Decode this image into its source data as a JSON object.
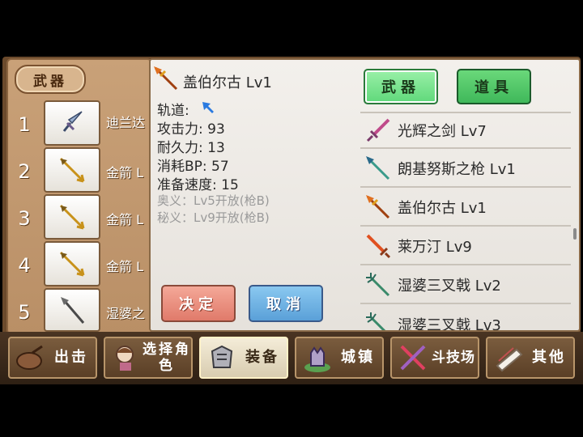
{
  "left_panel": {
    "tab_label": "武器",
    "slots": [
      {
        "num": "1",
        "name": "迪兰达"
      },
      {
        "num": "2",
        "name": "金箭 L"
      },
      {
        "num": "3",
        "name": "金箭 L"
      },
      {
        "num": "4",
        "name": "金箭 L"
      },
      {
        "num": "5",
        "name": "湿婆之"
      }
    ]
  },
  "detail": {
    "title": "盖伯尔古 Lv1",
    "track_label": "轨道:",
    "attack": "攻击力: 93",
    "durability": "耐久力: 13",
    "bp_cost": "消耗BP: 57",
    "prep_speed": "准备速度: 15",
    "secret1": "奥义：Lv5开放(枪B)",
    "secret2": "秘义：Lv9开放(枪B)",
    "confirm_label": "决定",
    "cancel_label": "取消",
    "tab_weapon": "武器",
    "tab_item": "道具"
  },
  "weapon_list": [
    {
      "name": "光辉之剑 Lv7",
      "icon": "sword-icon",
      "color": "#c04a8a"
    },
    {
      "name": "朗基努斯之枪 Lv1",
      "icon": "spear-icon",
      "color": "#3a9a8a"
    },
    {
      "name": "盖伯尔古 Lv1",
      "icon": "spear-icon",
      "color": "#d06a20"
    },
    {
      "name": "莱万汀 Lv9",
      "icon": "sword-icon",
      "color": "#e05020"
    },
    {
      "name": "湿婆三叉戟 Lv2",
      "icon": "trident-icon",
      "color": "#3a8a6a"
    },
    {
      "name": "湿婆三叉戟 Lv3",
      "icon": "trident-icon",
      "color": "#3a8a6a"
    }
  ],
  "nav": [
    {
      "label": "出击",
      "icon": "bag-icon"
    },
    {
      "label": "选择角色",
      "icon": "character-icon"
    },
    {
      "label": "装备",
      "icon": "armor-icon"
    },
    {
      "label": "城镇",
      "icon": "castle-icon"
    },
    {
      "label": "斗技场",
      "icon": "crossed-swords-icon"
    },
    {
      "label": "其他",
      "icon": "scroll-icon"
    }
  ],
  "colors": {
    "weapon_tab": "#5fd87a",
    "item_tab": "#3fb85a",
    "confirm": "#e88a7a",
    "cancel": "#6ab0e0",
    "frame": "#6b4a2c"
  }
}
